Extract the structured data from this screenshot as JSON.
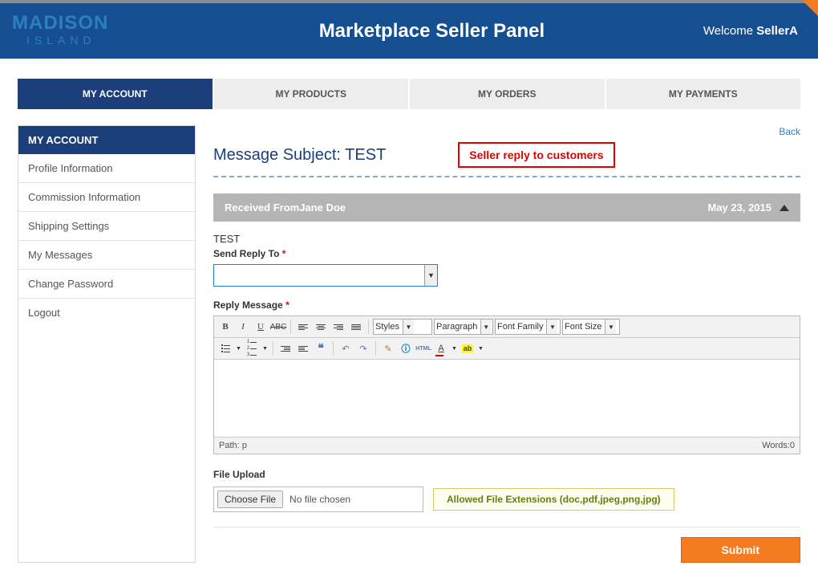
{
  "logo": {
    "top": "MADISON",
    "bottom": "ISLAND"
  },
  "header": {
    "title": "Marketplace Seller Panel",
    "welcome_prefix": "Welcome ",
    "welcome_user": "SellerA"
  },
  "tabs": [
    {
      "label": "MY ACCOUNT",
      "active": true
    },
    {
      "label": "MY PRODUCTS",
      "active": false
    },
    {
      "label": "MY ORDERS",
      "active": false
    },
    {
      "label": "MY PAYMENTS",
      "active": false
    }
  ],
  "sidebar": {
    "header": "MY ACCOUNT",
    "items": [
      "Profile Information",
      "Commission Information",
      "Shipping Settings",
      "My Messages",
      "Change Password",
      "Logout"
    ]
  },
  "back_link": "Back",
  "subject_prefix": "Message Subject: ",
  "subject_value": "TEST",
  "callout": "Seller reply to customers",
  "message": {
    "from_label": "Received From",
    "from_name": "Jane Doe",
    "date": "May 23, 2015",
    "body": "TEST"
  },
  "form": {
    "send_reply_label": "Send Reply To",
    "reply_msg_label": "Reply Message",
    "styles_label": "Styles",
    "paragraph_label": "Paragraph",
    "font_family_label": "Font Family",
    "font_size_label": "Font Size",
    "path_label": "Path: p",
    "words_label": "Words:0",
    "file_upload_label": "File Upload",
    "choose_file": "Choose File",
    "no_file": "No file chosen",
    "allowed_ext": "Allowed File Extensions (doc,pdf,jpeg,png,jpg)",
    "submit": "Submit"
  }
}
